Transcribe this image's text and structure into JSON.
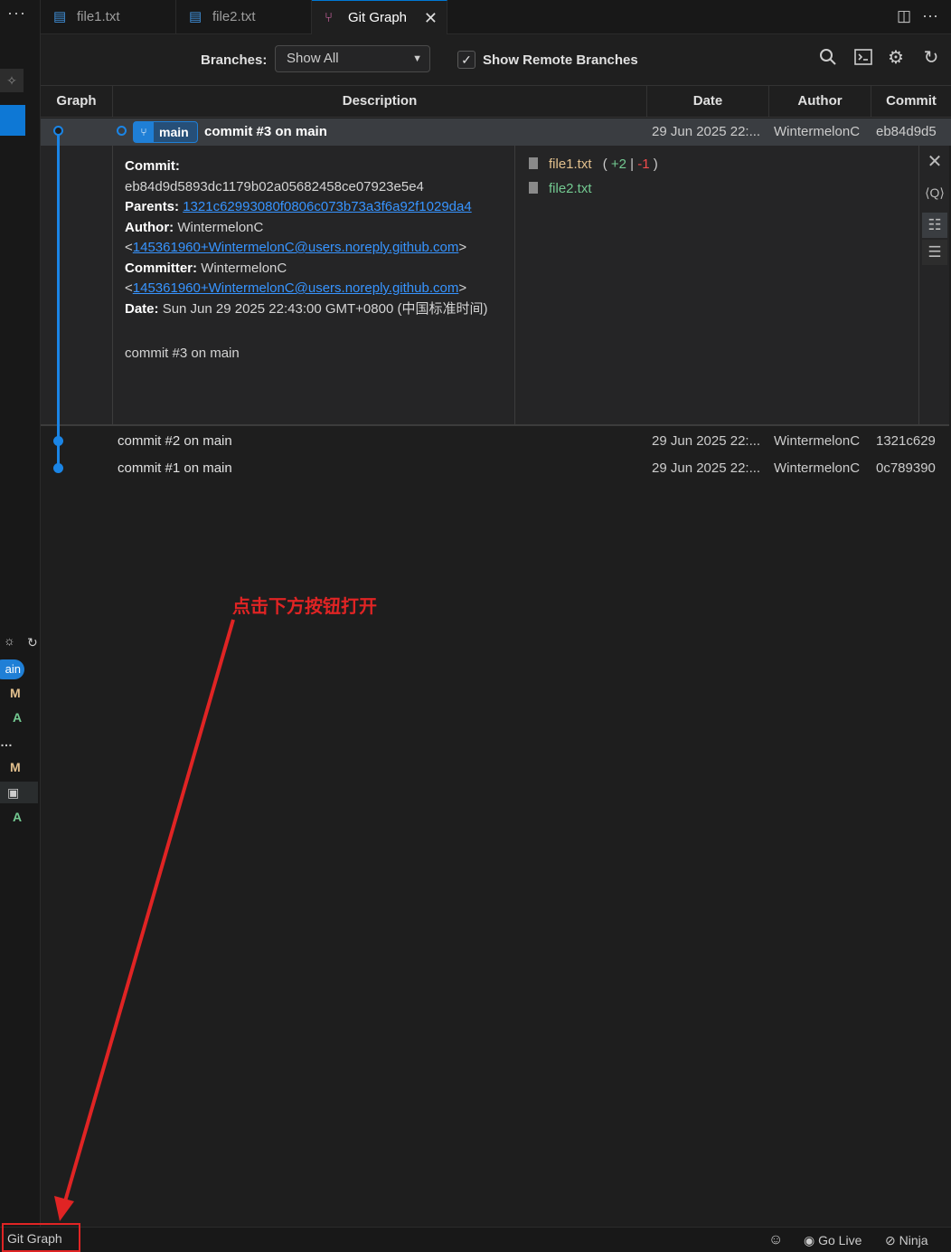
{
  "left": {
    "dots": "···",
    "branch_pill": "main",
    "pill_visible": "ain",
    "status_letters": [
      "M",
      "A",
      "M",
      "A"
    ]
  },
  "tabs": [
    {
      "label": "file1.txt",
      "icon": "file-icon"
    },
    {
      "label": "file2.txt",
      "icon": "file-icon"
    },
    {
      "label": "Git Graph",
      "icon": "git-graph-icon",
      "active": true
    }
  ],
  "controls": {
    "branches_label": "Branches:",
    "branches_value": "Show All",
    "show_remote_label": "Show Remote Branches",
    "show_remote_checked": true
  },
  "columns": [
    "Graph",
    "Description",
    "Date",
    "Author",
    "Commit"
  ],
  "commits": [
    {
      "branch": "main",
      "message": "commit #3 on main",
      "date": "29 Jun 2025 22:...",
      "author": "WintermelonC",
      "hash": "eb84d9d5"
    },
    {
      "message": "commit #2 on main",
      "date": "29 Jun 2025 22:...",
      "author": "WintermelonC",
      "hash": "1321c629"
    },
    {
      "message": "commit #1 on main",
      "date": "29 Jun 2025 22:...",
      "author": "WintermelonC",
      "hash": "0c789390"
    }
  ],
  "details": {
    "commit_label": "Commit:",
    "commit_hash": "eb84d9d5893dc1179b02a05682458ce07923e5e4",
    "parents_label": "Parents:",
    "parents": "1321c62993080f0806c073b73a3f6a92f1029da4",
    "author_label": "Author:",
    "author": "WintermelonC",
    "author_email": "145361960+WintermelonC@users.noreply.github.com",
    "committer_label": "Committer:",
    "committer": "WintermelonC",
    "committer_email": "145361960+WintermelonC@users.noreply.github.com",
    "date_label": "Date:",
    "date": "Sun Jun 29 2025 22:43:00 GMT+0800 (中国标准时间)",
    "message": "commit #3 on main",
    "files": [
      {
        "name": "file1.txt",
        "additions": "+2",
        "deletions": "-1",
        "status": "modified",
        "color": "#e2c08d"
      },
      {
        "name": "file2.txt",
        "status": "added",
        "color": "#73c991"
      }
    ]
  },
  "annotation": "点击下方按钮打开",
  "status_bar": {
    "git_graph": "Git Graph",
    "go_live": "Go Live",
    "ninja": "Ninja"
  },
  "colors": {
    "accent": "#1a85e6",
    "annotation_red": "#e02424",
    "modified": "#e2c08d",
    "added": "#73c991"
  }
}
